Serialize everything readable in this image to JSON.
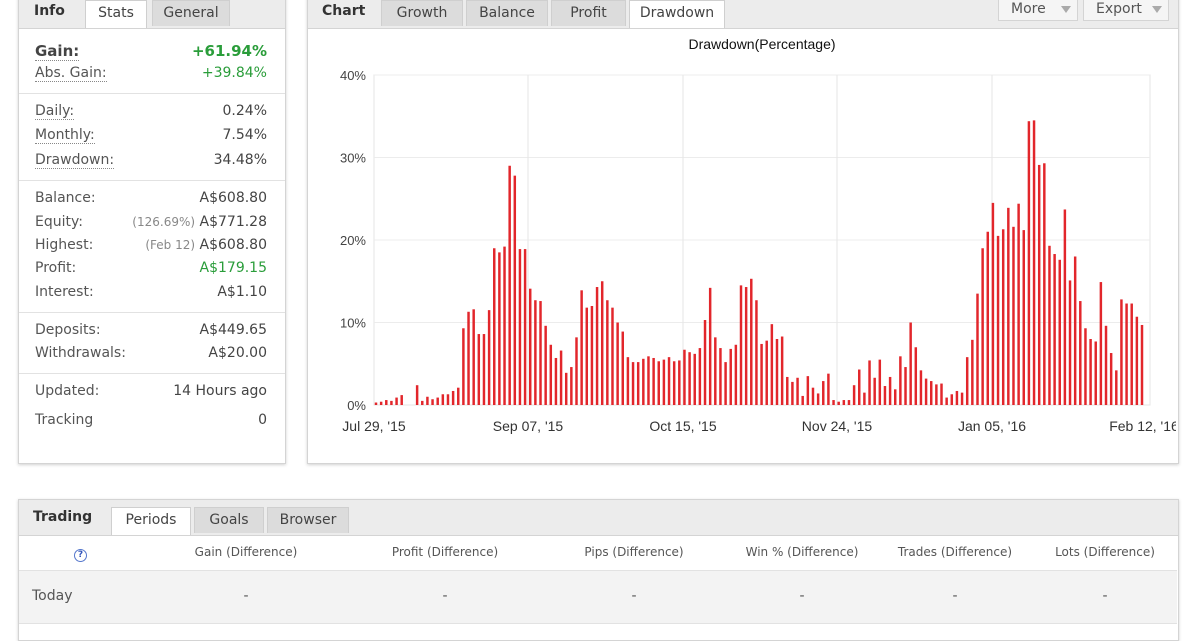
{
  "info": {
    "tabs": [
      "Info",
      "Stats",
      "General"
    ],
    "rows": [
      {
        "label": "Gain:",
        "prefix": "",
        "value": "+61.94%"
      },
      {
        "label": "Abs. Gain:",
        "prefix": "",
        "value": "+39.84%"
      },
      {
        "label": "Daily:",
        "prefix": "",
        "value": "0.24%"
      },
      {
        "label": "Monthly:",
        "prefix": "",
        "value": "7.54%"
      },
      {
        "label": "Drawdown:",
        "prefix": "",
        "value": "34.48%"
      },
      {
        "label": "Balance:",
        "prefix": "",
        "value": "A$608.80"
      },
      {
        "label": "Equity:",
        "prefix": "(126.69%)",
        "value": "A$771.28"
      },
      {
        "label": "Highest:",
        "prefix": "(Feb 12)",
        "value": "A$608.80"
      },
      {
        "label": "Profit:",
        "prefix": "",
        "value": "A$179.15"
      },
      {
        "label": "Interest:",
        "prefix": "",
        "value": "A$1.10"
      },
      {
        "label": "Deposits:",
        "prefix": "",
        "value": "A$449.65"
      },
      {
        "label": "Withdrawals:",
        "prefix": "",
        "value": "A$20.00"
      },
      {
        "label": "Updated:",
        "prefix": "",
        "value": "14 Hours ago"
      },
      {
        "label": "Tracking",
        "prefix": "",
        "value": "0"
      }
    ]
  },
  "chart_panel": {
    "tabs": [
      "Chart",
      "Growth",
      "Balance",
      "Profit",
      "Drawdown"
    ],
    "more_label": "More",
    "export_label": "Export"
  },
  "chart_data": {
    "type": "bar",
    "title": "Drawdown(Percentage)",
    "xlabel": "",
    "ylabel": "",
    "ylim": [
      0,
      40
    ],
    "y_ticks": [
      "0%",
      "10%",
      "20%",
      "30%",
      "40%"
    ],
    "x_ticks": [
      "Jul 29, '15",
      "Sep 07, '15",
      "Oct 15, '15",
      "Nov 24, '15",
      "Jan 05, '16",
      "Feb 12, '16"
    ],
    "grid": "vertical",
    "bar_color": "#e2262b",
    "values": [
      0.3,
      0.4,
      0.6,
      0.5,
      0.9,
      1.2,
      0,
      0,
      2.4,
      0.5,
      1,
      0.7,
      0.9,
      1.3,
      1.3,
      1.7,
      2.1,
      9.3,
      11.3,
      11.6,
      8.6,
      8.6,
      11.5,
      19,
      18.5,
      19.2,
      29,
      27.8,
      18.9,
      18.9,
      14.1,
      12.7,
      12.6,
      9.6,
      7.3,
      5.7,
      6.6,
      3.9,
      4.6,
      8.2,
      13.9,
      11.8,
      12,
      14.3,
      15,
      12.7,
      11.8,
      10,
      8.9,
      5.8,
      5.2,
      5.2,
      5.6,
      5.9,
      5.7,
      5.3,
      5.5,
      5.8,
      5.3,
      5.4,
      6.7,
      6.4,
      6.2,
      6.9,
      10.3,
      14.2,
      8.2,
      6.9,
      5.2,
      6.8,
      7.3,
      14.5,
      14.3,
      15.3,
      12.7,
      7.4,
      7.8,
      9.8,
      8,
      8.3,
      3.4,
      2.8,
      3.3,
      1.1,
      3.5,
      2.1,
      1.4,
      2.9,
      3.8,
      0.6,
      0.4,
      0.6,
      0.6,
      2.4,
      4.3,
      1.5,
      5.4,
      3.3,
      5.5,
      2.3,
      3.4,
      1.9,
      5.9,
      4.6,
      10,
      7,
      4.2,
      3.2,
      2.9,
      2.5,
      2.6,
      0.9,
      1.3,
      1.7,
      1.5,
      5.8,
      7.9,
      13.5,
      19,
      21,
      24.5,
      20.5,
      21.3,
      23.9,
      21.6,
      24.4,
      21.2,
      34.4,
      34.5,
      29.1,
      29.3,
      19.3,
      18.3,
      17.6,
      23.7,
      15.1,
      18,
      12.6,
      9.3,
      8,
      7.7,
      14.9,
      9.6,
      6.3,
      4.2,
      12.8,
      12.3,
      12.3,
      10.7,
      9.7
    ]
  },
  "trading": {
    "tabs": [
      "Trading",
      "Periods",
      "Goals",
      "Browser"
    ],
    "help_icon": "?",
    "columns": [
      "Gain (Difference)",
      "Profit (Difference)",
      "Pips (Difference)",
      "Win % (Difference)",
      "Trades (Difference)",
      "Lots (Difference)"
    ],
    "rows": [
      {
        "label": "Today",
        "cells": [
          "-",
          "-",
          "-",
          "-",
          "-",
          "-"
        ]
      }
    ]
  }
}
